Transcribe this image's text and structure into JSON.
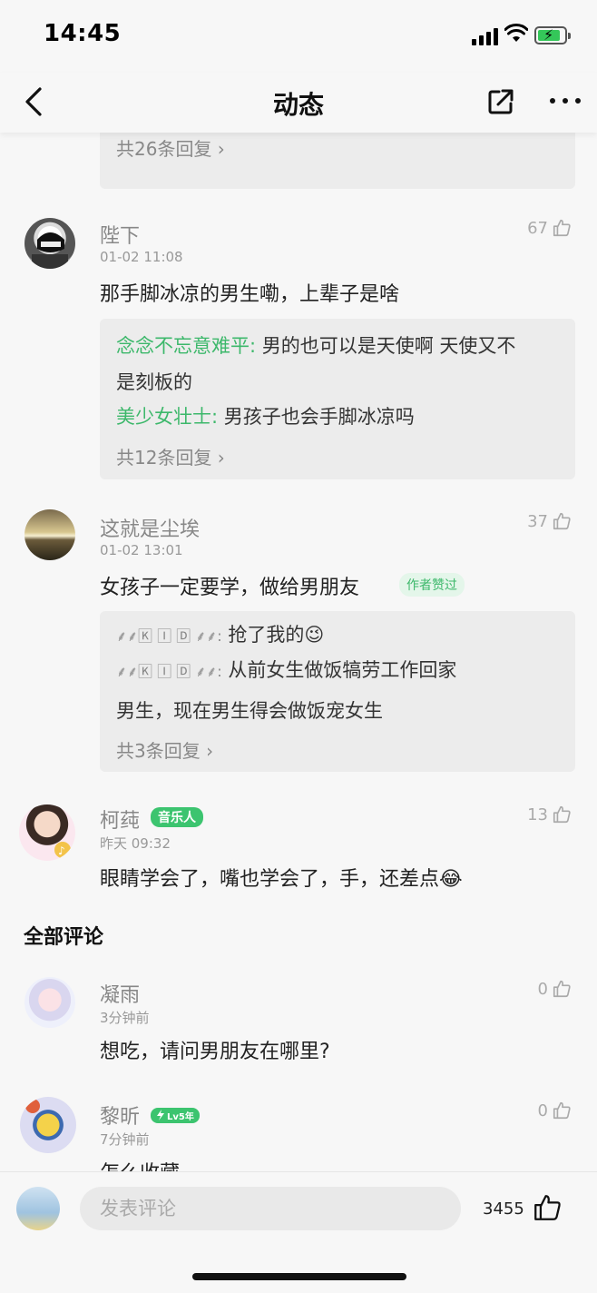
{
  "status": {
    "time": "14:45"
  },
  "nav": {
    "title": "动态"
  },
  "top_reply": {
    "more": "共26条回复 ›"
  },
  "comments": [
    {
      "name": "陛下",
      "time": "01-02 11:08",
      "likes": "67",
      "text": "那手脚冰凉的男生嘞，上辈子是啥",
      "replies": [
        {
          "name": "念念不忘意难平:",
          "text": " 男的也可以是天使啊 天使又不"
        },
        {
          "name": "",
          "text": "是刻板的"
        },
        {
          "name": "美少女壮士:",
          "text": " 男孩子也会手脚冰凉吗"
        }
      ],
      "more": "共12条回复 ›"
    },
    {
      "name": "这就是尘埃",
      "time": "01-02 13:01",
      "likes": "37",
      "text": "女孩子一定要学，做给男朋友",
      "badge": "作者赞过",
      "replies": [
        {
          "name": "⸙⸙🄺 🄸 🄳 ⸙⸙:",
          "text": " 抢了我的😉"
        },
        {
          "name": "⸙⸙🄺 🄸 🄳 ⸙⸙:",
          "text": " 从前女生做饭犒劳工作回家"
        },
        {
          "name": "",
          "text": "男生，现在男生得会做饭宠女生"
        }
      ],
      "more": "共3条回复 ›"
    },
    {
      "name": "柯莼",
      "badge": "音乐人",
      "time": "昨天 09:32",
      "likes": "13",
      "text": "眼睛学会了，嘴也学会了，手，还差点😂"
    }
  ],
  "all_comments_title": "全部评论",
  "all_comments": [
    {
      "name": "凝雨",
      "time": "3分钟前",
      "likes": "0",
      "text": "想吃，请问男朋友在哪里?"
    },
    {
      "name": "黎昕",
      "badge": "Lv5年",
      "time": "7分钟前",
      "likes": "0",
      "text": "怎么收藏"
    }
  ],
  "bottom": {
    "placeholder": "发表评论",
    "like_count": "3455"
  },
  "colors": {
    "accent": "#3db86b",
    "background": "#f7f7f7",
    "reply_bg": "#ececec"
  }
}
